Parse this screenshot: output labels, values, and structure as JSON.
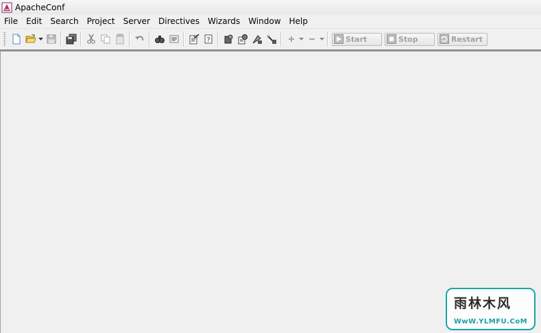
{
  "window": {
    "title": "ApacheConf"
  },
  "menu": [
    "File",
    "Edit",
    "Search",
    "Project",
    "Server",
    "Directives",
    "Wizards",
    "Window",
    "Help"
  ],
  "toolbar": {
    "icons": [
      "new-file-icon",
      "open-folder-icon",
      "save-icon",
      "save-all-icon",
      "cut-icon",
      "copy-icon",
      "paste-icon",
      "undo-icon",
      "find-icon",
      "replace-icon",
      "check-syntax-icon",
      "help-icon",
      "module-icon",
      "config-icon",
      "connect-icon",
      "disconnect-icon",
      "add-icon",
      "remove-icon"
    ],
    "server_buttons": {
      "start": "Start",
      "stop": "Stop",
      "restart": "Restart"
    }
  },
  "watermark": {
    "logo_text": "雨林木风",
    "url": "WwW.YLMFU.CoM"
  },
  "colors": {
    "watermark_accent": "#18a6a6",
    "workspace_bg": "#f0f0f0",
    "disabled_text": "#a2a2a2"
  }
}
